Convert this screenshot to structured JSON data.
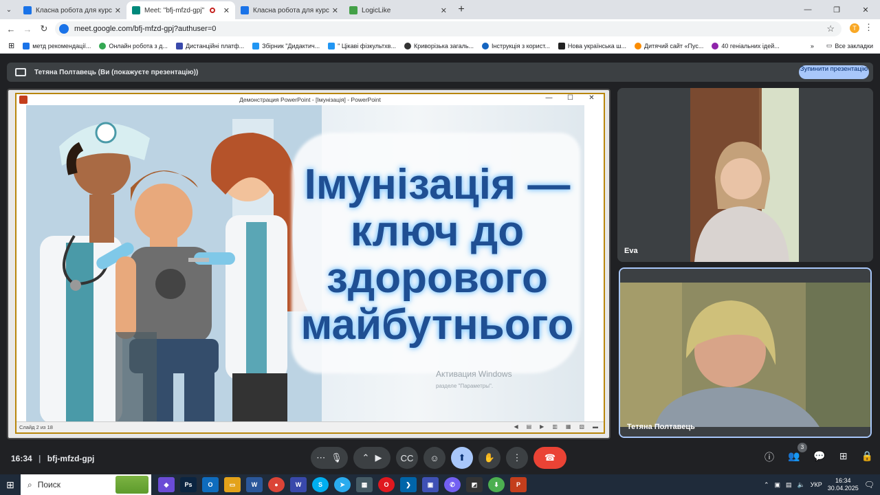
{
  "browser": {
    "tabs": [
      {
        "title": "Класна робота для курсу \"Ви",
        "color": "#1a73e8"
      },
      {
        "title": "Meet: \"bfj-mfzd-gpj\"",
        "color": "#00897b"
      },
      {
        "title": "Класна робота для курсу \"Ви",
        "color": "#1a73e8"
      },
      {
        "title": "LogicLike",
        "color": "#43a047"
      }
    ],
    "url": "meet.google.com/bfj-mfzd-gpj?authuser=0",
    "profile_initial": "T",
    "bookmarks": [
      "метд рекомендації...",
      "Онлайн робота з д...",
      "Дистанційні платф...",
      "Збірник \"Дидактич...",
      "\" Цікаві фізкультхв...",
      "Криворізька загаль...",
      "Інструкція з корист...",
      "Нова українська ш...",
      "Дитячий сайт «Пус...",
      "40 геніальних ідей..."
    ],
    "all_bookmarks": "Все закладки"
  },
  "meet": {
    "presenting_label": "Тетяна Полтавець (Ви (покажуєте презентацію))",
    "stop_button": "Зупинити презентацію",
    "ppt_window_title": "Демонстрация PowerPoint - [Імунізація] - PowerPoint",
    "slide_title_lines": [
      "Імунізація —",
      "ключ до",
      "здорового",
      "майбутнього"
    ],
    "watermark_title": "Активация Windows",
    "watermark_sub": "разделе \"Параметры\".",
    "slide_counter": "Слайд 2 из 18",
    "participants": [
      {
        "name": "Eva"
      },
      {
        "name": "Тетяна Полтавець"
      }
    ],
    "meeting_time": "16:34",
    "meeting_code": "bfj-mfzd-gpj",
    "participant_count": "3"
  },
  "taskbar": {
    "search_placeholder": "Поиск",
    "lang": "УКР",
    "time": "16:34",
    "date": "30.04.2025"
  }
}
